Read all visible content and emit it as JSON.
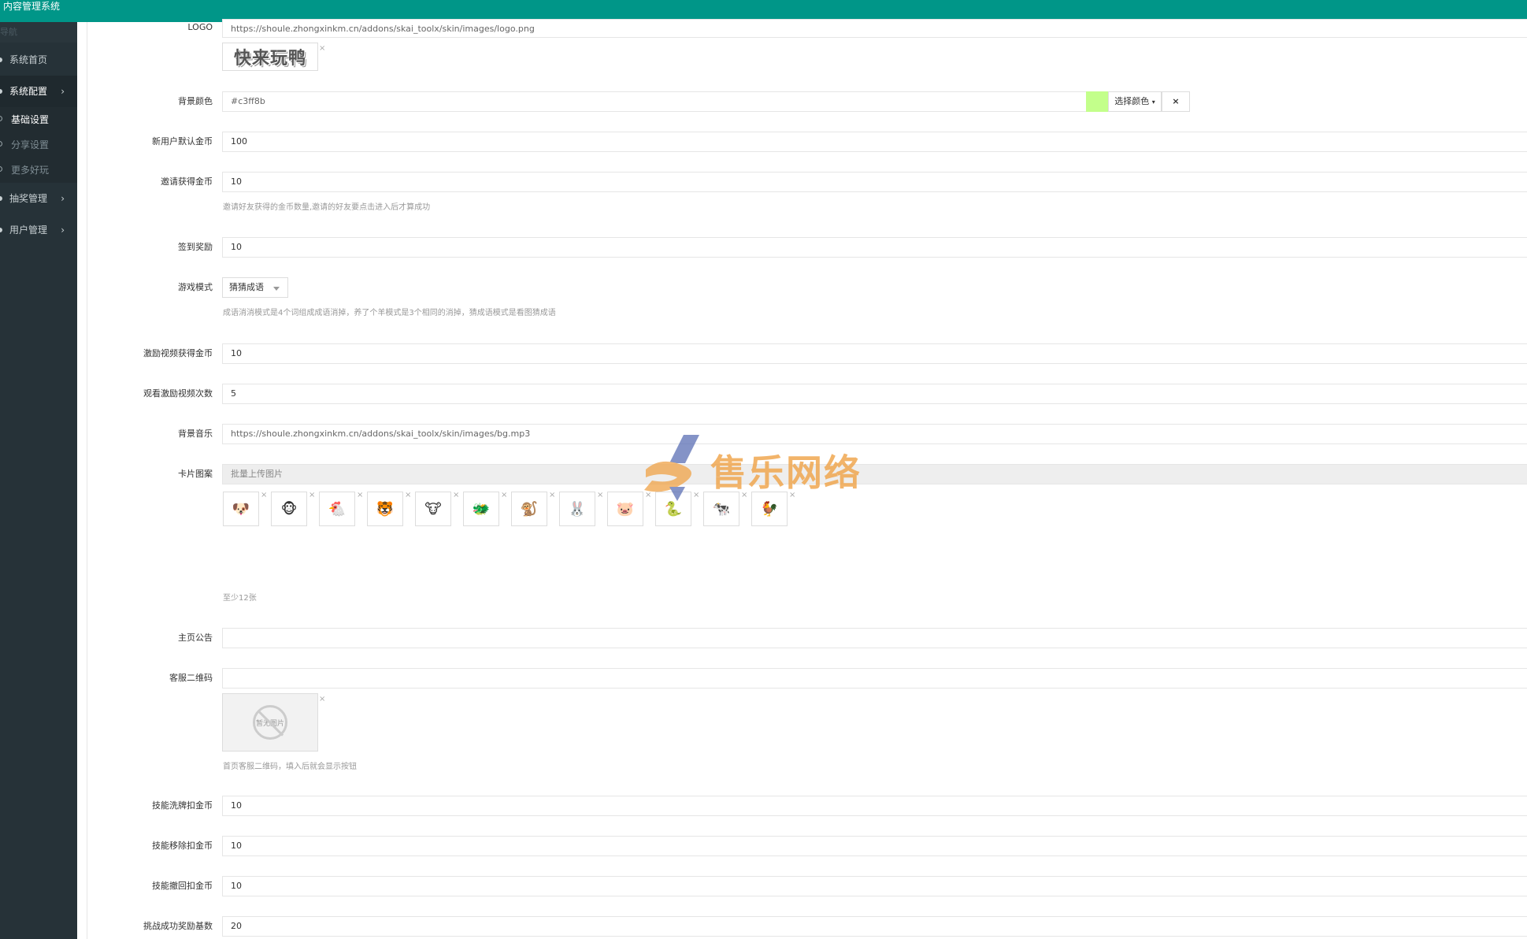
{
  "header": {
    "app_title": "内容管理系统"
  },
  "sidebar": {
    "heading": "导航",
    "items": [
      {
        "label": "系统首页"
      },
      {
        "label": "系统配置"
      },
      {
        "label": "抽奖管理"
      },
      {
        "label": "用户管理"
      }
    ],
    "sub_items": [
      {
        "label": "基础设置"
      },
      {
        "label": "分享设置"
      },
      {
        "label": "更多好玩"
      }
    ]
  },
  "form": {
    "logo": {
      "label": "LOGO",
      "value": "https://shoule.zhongxinkm.cn/addons/skai_toolx/skin/images/logo.png",
      "image_text": "快来玩鸭"
    },
    "bg_color": {
      "label": "背景颜色",
      "value": "#c3ff8b",
      "swatch": "#c3ff8b",
      "choose_label": "选择颜色",
      "clear_label": "×"
    },
    "new_user_coins": {
      "label": "新用户默认金币",
      "value": "100"
    },
    "invite_coins": {
      "label": "邀请获得金币",
      "value": "10",
      "help": "邀请好友获得的金币数量,邀请的好友要点击进入后才算成功"
    },
    "checkin_reward": {
      "label": "签到奖励",
      "value": "10"
    },
    "game_mode": {
      "label": "游戏模式",
      "value": "猜猜成语",
      "help": "成语消消模式是4个词组成成语消掉，养了个羊模式是3个相同的消掉，猜成语模式是看图猜成语"
    },
    "video_coins": {
      "label": "激励视频获得金币",
      "value": "10"
    },
    "video_times": {
      "label": "观看激励视频次数",
      "value": "5"
    },
    "bg_music": {
      "label": "背景音乐",
      "value": "https://shoule.zhongxinkm.cn/addons/skai_toolx/skin/images/bg.mp3"
    },
    "card_pattern": {
      "label": "卡片图案",
      "upload_label": "批量上传图片",
      "help": "至少12张",
      "icons": [
        "dog-icon",
        "monkey-face-icon",
        "chicken-icon",
        "tiger-icon",
        "ox-icon",
        "dragon-icon",
        "monkey-icon",
        "rabbit-icon",
        "pig-icon",
        "snake-icon",
        "cow-icon",
        "rooster-icon"
      ],
      "glyphs": [
        "🐶",
        "🐵",
        "🐔",
        "🐯",
        "🐮",
        "🐲",
        "🐒",
        "🐰",
        "🐷",
        "🐍",
        "🐄",
        "🐓"
      ]
    },
    "announcement": {
      "label": "主页公告",
      "value": ""
    },
    "service_qr": {
      "label": "客服二维码",
      "value": "",
      "placeholder_text": "暂无图片",
      "help": "首页客服二维码，填入后就会显示按钮"
    },
    "shuffle_cost": {
      "label": "技能洗牌扣金币",
      "value": "10"
    },
    "remove_cost": {
      "label": "技能移除扣金币",
      "value": "10"
    },
    "undo_cost": {
      "label": "技能撤回扣金币",
      "value": "10"
    },
    "challenge_reward": {
      "label": "挑战成功奖励基数",
      "value": "20"
    }
  },
  "watermark": {
    "text": "售乐网络"
  },
  "colors": {
    "topbar": "#009688",
    "sidebar": "#263238",
    "watermark_blue": "#5b6fb5",
    "watermark_orange": "#f0a246"
  }
}
